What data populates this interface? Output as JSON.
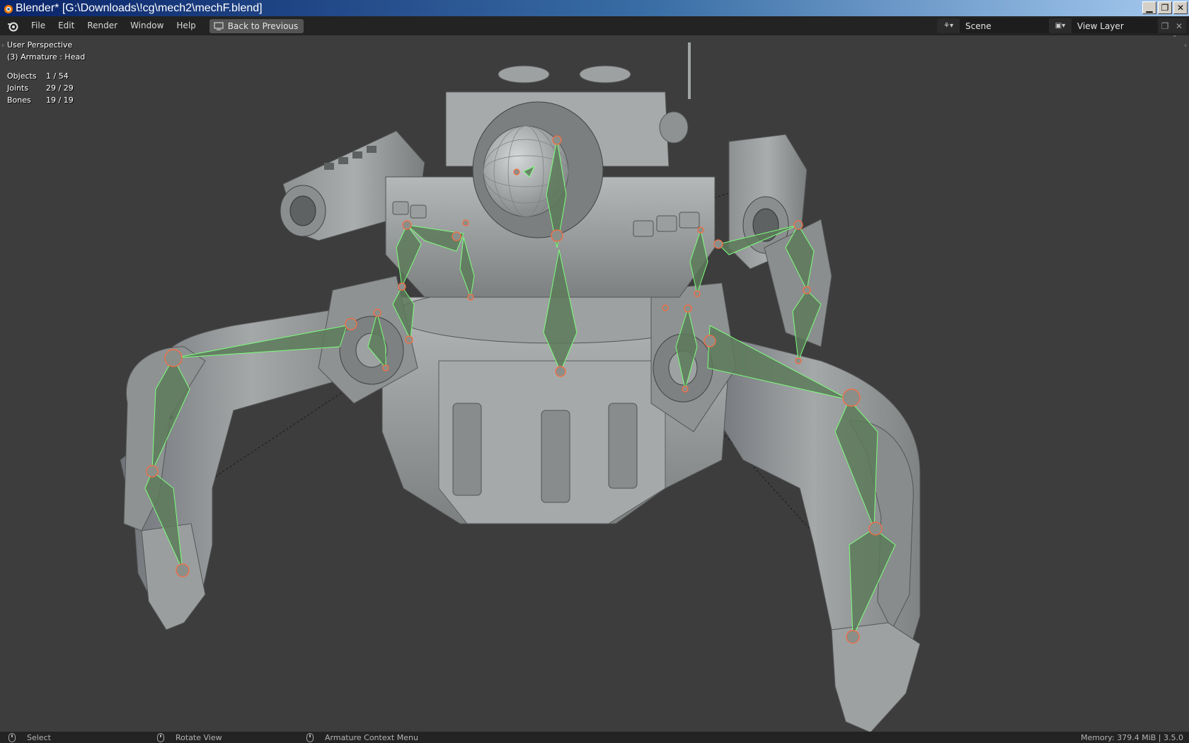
{
  "window": {
    "title": "Blender* [G:\\Downloads\\!cg\\mech2\\mechF.blend]",
    "min_glyph": "▁",
    "max_glyph": "❐",
    "close_glyph": "✕"
  },
  "menubar": {
    "items": [
      "File",
      "Edit",
      "Render",
      "Window",
      "Help"
    ],
    "back_button": "Back to Previous",
    "scene": "Scene",
    "view_layer": "View Layer"
  },
  "viewport": {
    "perspective": "User Perspective",
    "active": "(3) Armature : Head",
    "stats": [
      {
        "label": "Objects",
        "value": "1 / 54"
      },
      {
        "label": "Joints",
        "value": "29 / 29"
      },
      {
        "label": "Bones",
        "value": "19 / 19"
      }
    ]
  },
  "statusbar": {
    "select": "Select",
    "rotate": "Rotate View",
    "context": "Armature Context Menu",
    "memory": "Memory: 379.4 MiB | 3.5.0"
  },
  "colors": {
    "bone_fill": "#5d7a5a",
    "bone_outline": "#7dff7d",
    "joint": "#ff6a3d",
    "mesh_light": "#9ea2a2",
    "mesh_dark": "#6f7373"
  }
}
